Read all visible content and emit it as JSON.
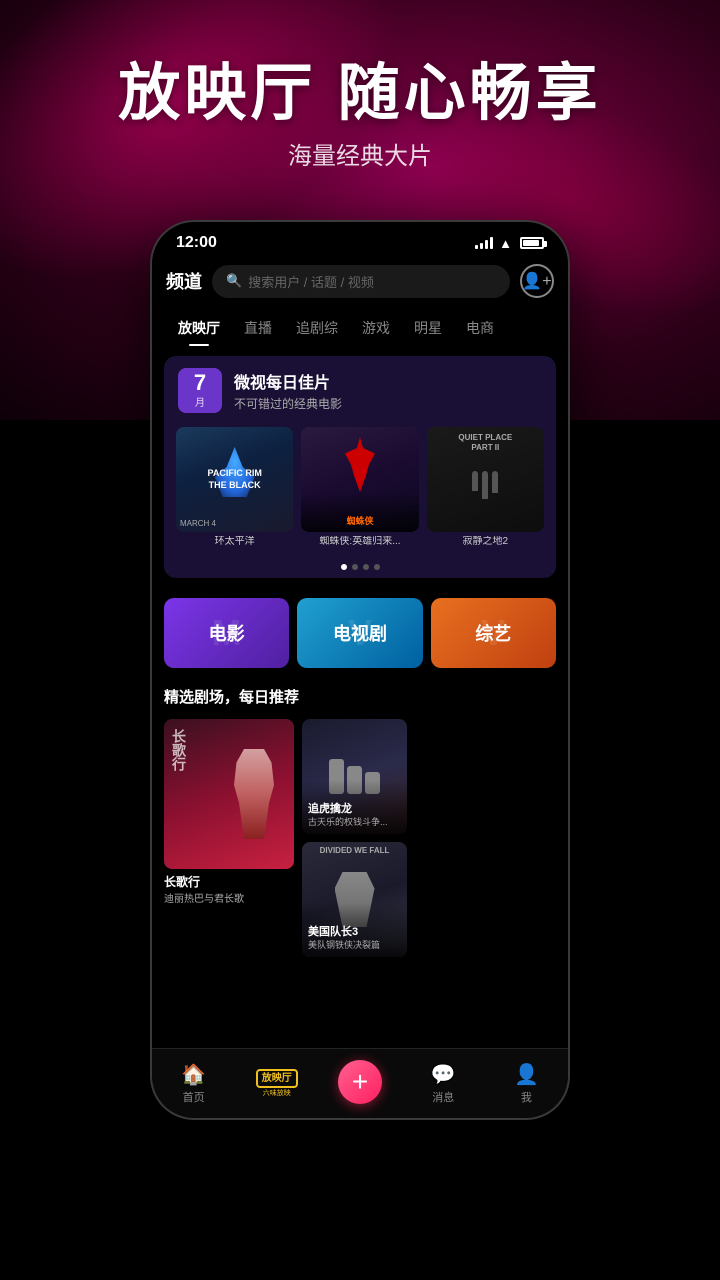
{
  "hero": {
    "title": "放映厅 随心畅享",
    "subtitle": "海量经典大片"
  },
  "phone": {
    "status": {
      "time": "12:00"
    },
    "header": {
      "logo": "频道",
      "search_placeholder": "搜索用户 / 话题 / 视频"
    },
    "nav_tabs": [
      {
        "label": "放映厅",
        "active": true
      },
      {
        "label": "直播",
        "active": false
      },
      {
        "label": "追剧综",
        "active": false
      },
      {
        "label": "游戏",
        "active": false
      },
      {
        "label": "明星",
        "active": false
      },
      {
        "label": "电商",
        "active": false
      }
    ],
    "featured_card": {
      "date_day": "7",
      "date_month": "月",
      "title": "微视每日佳片",
      "subtitle": "不可错过的经典电影"
    },
    "movies": [
      {
        "label": "环太平洋",
        "title_en": "PACIFIC RIM THE BLACK"
      },
      {
        "label": "蜘蛛侠:英雄归来...",
        "title_cn": "蜘蛛侠"
      },
      {
        "label": "寂静之地2",
        "title_cn": "寂静之地2"
      }
    ],
    "categories": [
      {
        "label": "电影",
        "type": "movie"
      },
      {
        "label": "电视剧",
        "type": "tv"
      },
      {
        "label": "综艺",
        "type": "variety"
      }
    ],
    "section_title": "精选剧场，每日推荐",
    "dramas": [
      {
        "name": "长歌行",
        "desc": "迪丽热巴与君长歌",
        "size": "main"
      },
      {
        "name": "追虎擒龙",
        "desc": "古天乐的权钱斗争...",
        "size": "small"
      },
      {
        "name": "美国队长3",
        "desc": "美队钢铁侠决裂篇",
        "size": "small"
      }
    ],
    "bottom_nav": [
      {
        "label": "首页",
        "icon": "🏠",
        "active": false
      },
      {
        "label": "放映厅",
        "icon": "tv",
        "active": true
      },
      {
        "label": "+",
        "icon": "+",
        "active": false
      },
      {
        "label": "消息",
        "icon": "💬",
        "active": false
      },
      {
        "label": "我",
        "icon": "👤",
        "active": false
      }
    ]
  }
}
